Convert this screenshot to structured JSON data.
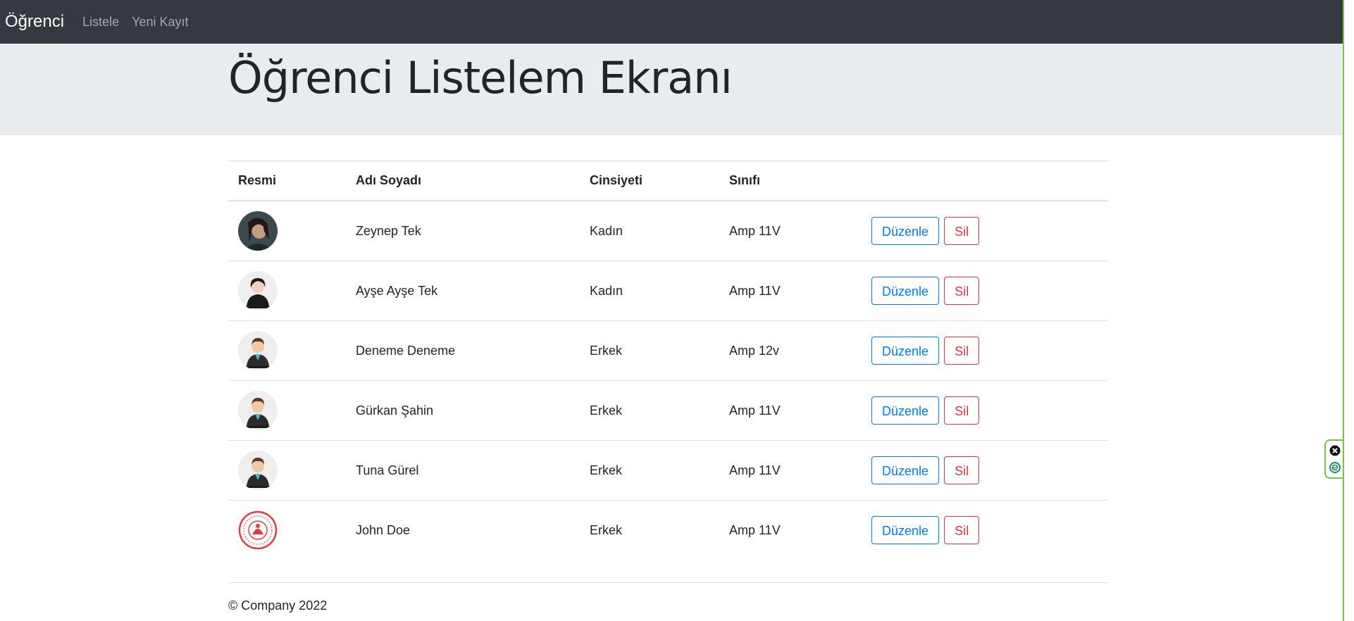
{
  "navbar": {
    "brand": "Öğrenci",
    "links": [
      "Listele",
      "Yeni Kayıt"
    ]
  },
  "jumbotron": {
    "title": "Öğrenci Listelem Ekranı"
  },
  "table": {
    "headers": [
      "Resmi",
      "Adı Soyadı",
      "Cinsiyeti",
      "Sınıfı"
    ],
    "rows": [
      {
        "avatar": "photo-woman",
        "name": "Zeynep Tek",
        "gender": "Kadın",
        "class": "Amp 11V"
      },
      {
        "avatar": "female-avatar",
        "name": "Ayşe Ayşe Tek",
        "gender": "Kadın",
        "class": "Amp 11V"
      },
      {
        "avatar": "male-avatar",
        "name": "Deneme Deneme",
        "gender": "Erkek",
        "class": "Amp 12v"
      },
      {
        "avatar": "male-avatar",
        "name": "Gürkan Şahin",
        "gender": "Erkek",
        "class": "Amp 11V"
      },
      {
        "avatar": "male-avatar",
        "name": "Tuna Gürel",
        "gender": "Erkek",
        "class": "Amp 11V"
      },
      {
        "avatar": "red-seal-logo",
        "name": "John Doe",
        "gender": "Erkek",
        "class": "Amp 11V"
      }
    ],
    "edit_label": "Düzenle",
    "delete_label": "Sil"
  },
  "footer": {
    "text": "© Company 2022"
  },
  "colors": {
    "navbar": "#343a40",
    "jumbotron": "#e9ecef",
    "primary": "#007bff",
    "danger": "#dc3545"
  }
}
